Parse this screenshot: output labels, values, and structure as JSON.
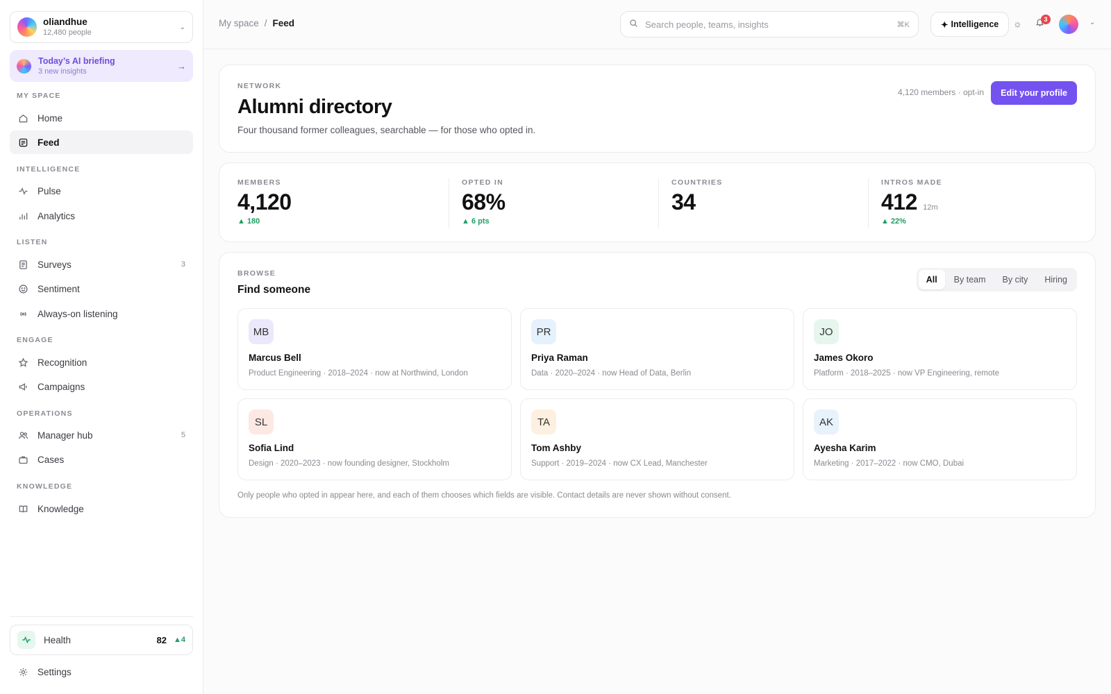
{
  "org": {
    "name": "oliandhue",
    "people": "12,480 people"
  },
  "briefing": {
    "title": "Today’s AI briefing",
    "subtitle": "3 new insights"
  },
  "nav": {
    "my_space": "MY SPACE",
    "home": "Home",
    "feed": "Feed",
    "intelligence": "INTELLIGENCE",
    "pulse": "Pulse",
    "analytics": "Analytics",
    "listen": "LISTEN",
    "surveys": "Surveys",
    "surveys_count": "3",
    "sentiment": "Sentiment",
    "always_on": "Always-on listening",
    "engage": "ENGAGE",
    "recognition": "Recognition",
    "campaigns": "Campaigns",
    "operations": "OPERATIONS",
    "manager_hub": "Manager hub",
    "manager_hub_count": "5",
    "cases": "Cases",
    "knowledge_section": "KNOWLEDGE",
    "knowledge": "Knowledge",
    "settings": "Settings"
  },
  "health": {
    "label": "Health",
    "score": "82",
    "delta": "▲4"
  },
  "topbar": {
    "crumb_root": "My space",
    "crumb_sep": "/",
    "crumb_current": "Feed",
    "search_placeholder": "Search people, teams, insights",
    "search_shortcut": "⌘K",
    "intelligence_label": "Intelligence",
    "notification_count": "3"
  },
  "hero": {
    "eyebrow": "NETWORK",
    "title": "Alumni directory",
    "description": "Four thousand former colleagues, searchable — for those who opted in.",
    "meta": "4,120 members · opt-in",
    "cta": "Edit your profile"
  },
  "stats": [
    {
      "label": "MEMBERS",
      "value": "4,120",
      "unit": "",
      "change": "▲ 180"
    },
    {
      "label": "OPTED IN",
      "value": "68%",
      "unit": "",
      "change": "▲ 6 pts"
    },
    {
      "label": "COUNTRIES",
      "value": "34",
      "unit": "",
      "change": ""
    },
    {
      "label": "INTROS MADE",
      "value": "412",
      "unit": "12m",
      "change": "▲ 22%"
    }
  ],
  "browse": {
    "eyebrow": "BROWSE",
    "title": "Find someone",
    "filters": [
      "All",
      "By team",
      "By city",
      "Hiring"
    ],
    "people": [
      {
        "initials": "MB",
        "name": "Marcus Bell",
        "details": "Product Engineering · 2018–2024 · now at Northwind, London",
        "color": "#ece8fb"
      },
      {
        "initials": "PR",
        "name": "Priya Raman",
        "details": "Data · 2020–2024 · now Head of Data, Berlin",
        "color": "#e5f1fc"
      },
      {
        "initials": "JO",
        "name": "James Okoro",
        "details": "Platform · 2018–2025 · now VP Engineering, remote",
        "color": "#e6f6ee"
      },
      {
        "initials": "SL",
        "name": "Sofia Lind",
        "details": "Design · 2020–2023 · now founding designer, Stockholm",
        "color": "#fce9e3"
      },
      {
        "initials": "TA",
        "name": "Tom Ashby",
        "details": "Support · 2019–2024 · now CX Lead, Manchester",
        "color": "#fdf0e0"
      },
      {
        "initials": "AK",
        "name": "Ayesha Karim",
        "details": "Marketing · 2017–2022 · now CMO, Dubai",
        "color": "#e8f2fc"
      }
    ],
    "note": "Only people who opted in appear here, and each of them chooses which fields are visible. Contact details are never shown without consent."
  },
  "colors": {
    "accent": "#7452f0",
    "positive": "#1e9e62",
    "badge": "#e5484d"
  }
}
